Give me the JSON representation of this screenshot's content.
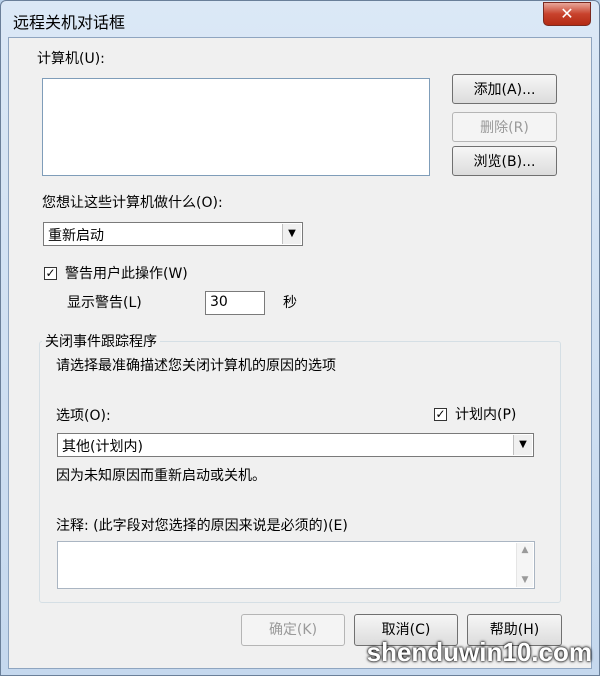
{
  "window": {
    "title": "远程关机对话框",
    "close_glyph": "✕"
  },
  "computers": {
    "label": "计算机(U):",
    "add_button": "添加(A)...",
    "remove_button": "删除(R)",
    "browse_button": "浏览(B)..."
  },
  "action": {
    "label": "您想让这些计算机做什么(O):",
    "selected": "重新启动"
  },
  "warn": {
    "checkbox_label": "警告用户此操作(W)",
    "checked": true,
    "display_label": "显示警告(L)",
    "seconds_value": "30",
    "seconds_unit": "秒"
  },
  "tracker": {
    "legend": "关闭事件跟踪程序",
    "instruction": "请选择最准确描述您关闭计算机的原因的选项",
    "option_label": "选项(O):",
    "planned_label": "计划内(P)",
    "planned_checked": true,
    "selected_option": "其他(计划内)",
    "description": "因为未知原因而重新启动或关机。",
    "comment_label": "注释: (此字段对您选择的原因来说是必须的)(E)",
    "comment_value": ""
  },
  "footer": {
    "ok_button": "确定(K)",
    "cancel_button": "取消(C)",
    "help_button": "帮助(H)"
  },
  "watermark": "shenduwin10.com"
}
